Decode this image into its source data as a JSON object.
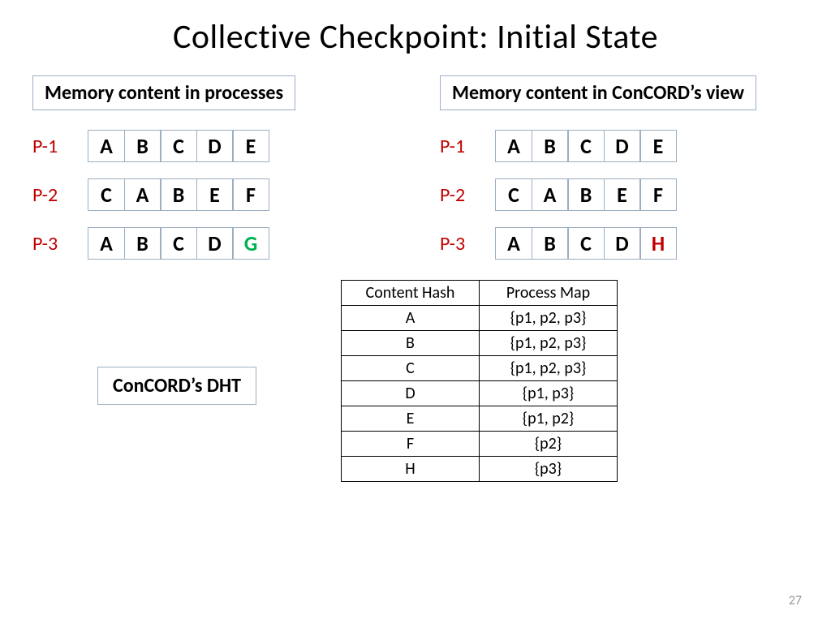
{
  "title": "Collective Checkpoint: Initial State",
  "left": {
    "heading": "Memory content in processes",
    "rows": [
      {
        "pid": "P-1",
        "cells": [
          {
            "v": "A",
            "c": ""
          },
          {
            "v": "B",
            "c": ""
          },
          {
            "v": "C",
            "c": ""
          },
          {
            "v": "D",
            "c": ""
          },
          {
            "v": "E",
            "c": ""
          }
        ]
      },
      {
        "pid": "P-2",
        "cells": [
          {
            "v": "C",
            "c": ""
          },
          {
            "v": "A",
            "c": ""
          },
          {
            "v": "B",
            "c": ""
          },
          {
            "v": "E",
            "c": ""
          },
          {
            "v": "F",
            "c": ""
          }
        ]
      },
      {
        "pid": "P-3",
        "cells": [
          {
            "v": "A",
            "c": ""
          },
          {
            "v": "B",
            "c": ""
          },
          {
            "v": "C",
            "c": ""
          },
          {
            "v": "D",
            "c": ""
          },
          {
            "v": "G",
            "c": "green"
          }
        ]
      }
    ]
  },
  "right": {
    "heading": "Memory content in ConCORD’s view",
    "rows": [
      {
        "pid": "P-1",
        "cells": [
          {
            "v": "A",
            "c": ""
          },
          {
            "v": "B",
            "c": ""
          },
          {
            "v": "C",
            "c": ""
          },
          {
            "v": "D",
            "c": ""
          },
          {
            "v": "E",
            "c": ""
          }
        ]
      },
      {
        "pid": "P-2",
        "cells": [
          {
            "v": "C",
            "c": ""
          },
          {
            "v": "A",
            "c": ""
          },
          {
            "v": "B",
            "c": ""
          },
          {
            "v": "E",
            "c": ""
          },
          {
            "v": "F",
            "c": ""
          }
        ]
      },
      {
        "pid": "P-3",
        "cells": [
          {
            "v": "A",
            "c": ""
          },
          {
            "v": "B",
            "c": ""
          },
          {
            "v": "C",
            "c": ""
          },
          {
            "v": "D",
            "c": ""
          },
          {
            "v": "H",
            "c": "red"
          }
        ]
      }
    ]
  },
  "dht_label": "ConCORD’s DHT",
  "dht": {
    "headers": [
      "Content Hash",
      "Process Map"
    ],
    "rows": [
      [
        "A",
        "{p1, p2, p3}"
      ],
      [
        "B",
        "{p1, p2, p3}"
      ],
      [
        "C",
        "{p1, p2, p3}"
      ],
      [
        "D",
        "{p1, p3}"
      ],
      [
        "E",
        "{p1, p2}"
      ],
      [
        "F",
        "{p2}"
      ],
      [
        "H",
        "{p3}"
      ]
    ]
  },
  "page": "27"
}
